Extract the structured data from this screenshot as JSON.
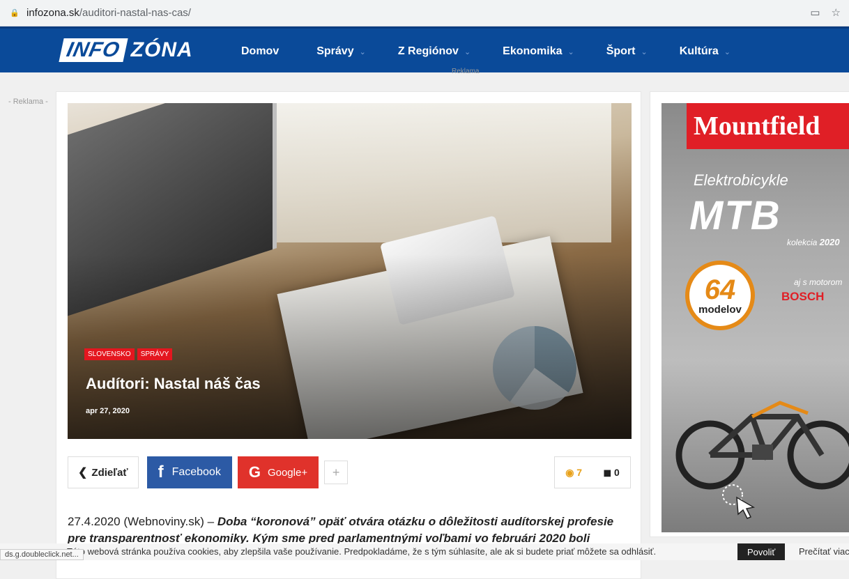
{
  "browser": {
    "url_host": "infozona.sk",
    "url_path": "/auditori-nastal-nas-cas/"
  },
  "logo": {
    "part1": "INFO",
    "part2": "ZÓNA"
  },
  "menu": [
    {
      "label": "Domov",
      "chevron": ""
    },
    {
      "label": "Správy",
      "chevron": "⌄"
    },
    {
      "label": "Z Regiónov",
      "chevron": "⌄"
    },
    {
      "label": "Ekonomika",
      "chevron": "⌄"
    },
    {
      "label": "Šport",
      "chevron": "⌄"
    },
    {
      "label": "Kultúra",
      "chevron": "⌄"
    }
  ],
  "ads": {
    "top_label": "Reklama",
    "left_label": "- Reklama -"
  },
  "article": {
    "tags": [
      "SLOVENSKO",
      "SPRÁVY"
    ],
    "title": "Audítori: Nastal náš čas",
    "date": "apr 27, 2020",
    "body_plain": "27.4.2020 (Webnoviny.sk) – ",
    "body_bold": "Doba “koronová” opäť otvára otázku o dôležitosti audítorskej profesie",
    "body_line2": "pre transparentnosť ekonomiky. Kým sme pred parlamentnými voľbami vo februári 2020 boli"
  },
  "share": {
    "label": "Zdieľať",
    "facebook": "Facebook",
    "google": "Google+",
    "plus": "+",
    "views": "7",
    "comments": "0"
  },
  "side_ad": {
    "brand": "Mountfield",
    "line1": "Elektrobicykle",
    "line2": "MTB",
    "kolekcia_prefix": "kolekcia ",
    "kolekcia_year": "2020",
    "count": "64",
    "count_label": "modelov",
    "motor": "aj s motorom",
    "bosch": "BOSCH"
  },
  "cookie": {
    "text": "Táto webová stránka používa cookies, aby zlepšila vaše používanie. Predpokladáme, že s tým súhlasíte, ale ak si budete priať môžete sa odhlásiť.",
    "accept": "Povoliť",
    "more": "Prečítať viac"
  },
  "status_bar": "ds.g.doubleclick.net...",
  "colors": {
    "nav": "#0a4a99",
    "accent_red": "#e4161f",
    "facebook": "#2c5aa5",
    "google": "#e0322b"
  }
}
